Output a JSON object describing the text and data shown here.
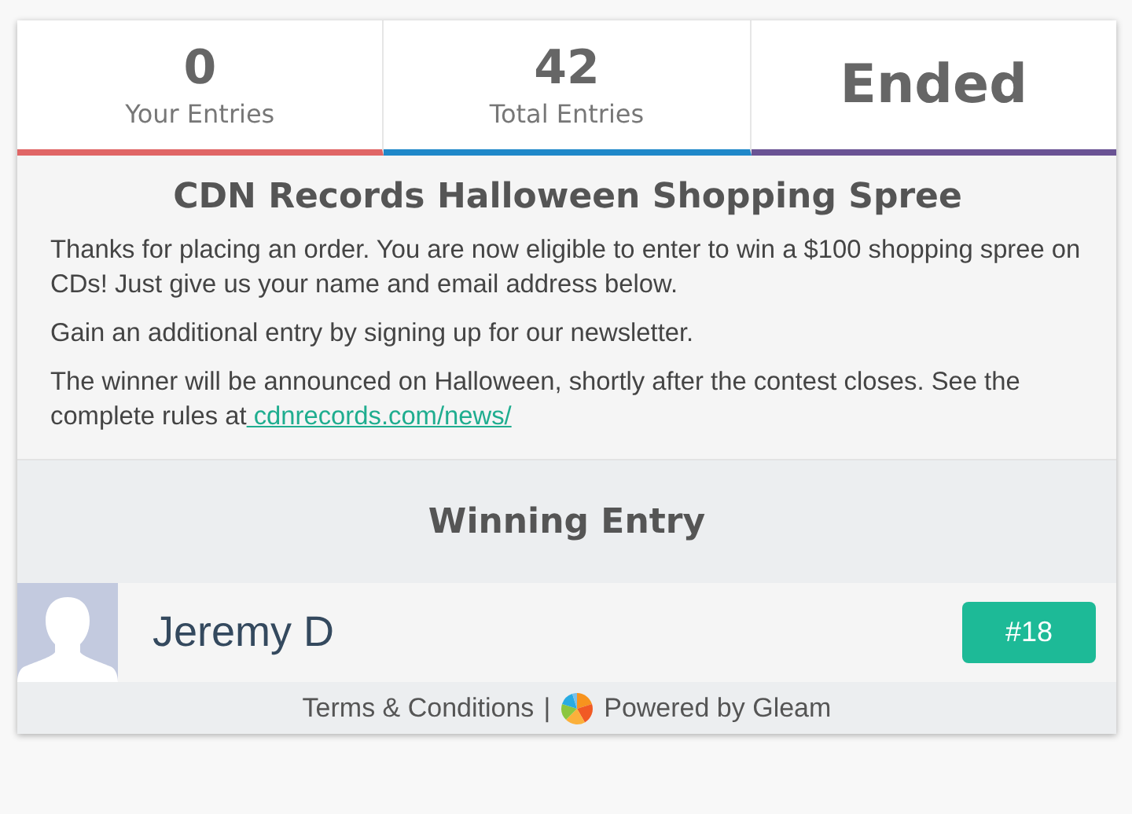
{
  "stats": [
    {
      "value": "0",
      "label": "Your Entries",
      "color": "#e06666"
    },
    {
      "value": "42",
      "label": "Total Entries",
      "color": "#1f88c9"
    },
    {
      "value": "Ended",
      "color": "#6a5394"
    }
  ],
  "title": "CDN Records Halloween Shopping Spree",
  "paragraphs": [
    {
      "text": "Thanks for placing an order. You are now eligible to enter to win a $100 shopping spree on CDs! Just give us your name and email address below."
    },
    {
      "text": "Gain an additional entry by signing up for our newsletter."
    },
    {
      "text": "The winner will be announced on Halloween, shortly after the contest closes. See the complete rules at",
      "link": " cdnrecords.com/news/"
    }
  ],
  "winner": {
    "heading": "Winning Entry",
    "name": "Jeremy D",
    "entry": "#18"
  },
  "footer": {
    "terms": "Terms & Conditions",
    "separator": "|",
    "powered": "Powered by Gleam"
  }
}
